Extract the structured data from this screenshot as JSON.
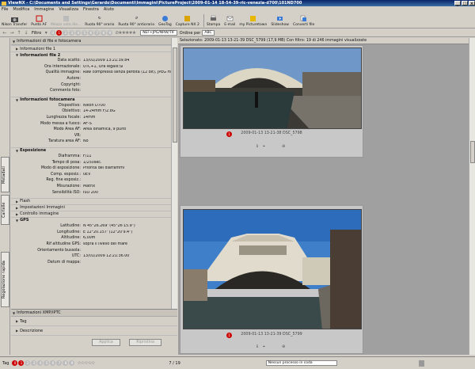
{
  "window": {
    "title": "ViewNX - C:\\Documents and Settings\\Gerardo\\Documenti\\Immagini\\PictureProject\\2009-01-14 18-54-39-ric-venezia-d700\\101ND700",
    "min": "_",
    "max": "□",
    "close": "×"
  },
  "menu": [
    "File",
    "Modifica",
    "Immagine",
    "Visualizza",
    "Finestra",
    "Aiuto"
  ],
  "toolbar": {
    "nikon_transfer": "Nikon Transfer",
    "punto_af": "Punto AF",
    "mezzo_voto": "Mezzo voto die...",
    "ruota_orario": "Ruota 90° orario",
    "ruota_antiorario": "Ruota 90° antiorario",
    "geotag": "GeoTag",
    "capture_nx2": "Capture NX 2",
    "stampa": "Stampa",
    "email": "E-mail",
    "my_picturetown": "my Picturetown",
    "slideshow": "Slideshow",
    "converti_file": "Converti file"
  },
  "filterbar": {
    "filtro": "Filtro",
    "labels": [
      "0",
      "1",
      "2",
      "3",
      "4",
      "5",
      "6",
      "7",
      "8",
      "9"
    ],
    "format_filter": "NEF+JPG/NRW/TIF",
    "sort_label": "Ordine per",
    "sort_icon": "ABC"
  },
  "sidetabs": {
    "metadati": "Metadati",
    "cartelle": "Cartelle",
    "regolazione": "Regolazione rapida"
  },
  "panel": {
    "header": "Informazioni di file e fotocamera",
    "file1": "Informazioni file 1",
    "file2": "Informazioni file 2",
    "file2_rows": [
      {
        "k": "Data scatto:",
        "v": "13/01/2009 13:21:39.84"
      },
      {
        "k": "Ora internazionale:",
        "v": "UTC+1, Ora legale:Sì"
      },
      {
        "k": "Qualità immagine:",
        "v": "Raw compresso senza perdita (12 bit), JPEG Fine"
      },
      {
        "k": "Autore:",
        "v": ""
      },
      {
        "k": "Copyright:",
        "v": ""
      },
      {
        "k": "Commento foto:",
        "v": ""
      }
    ],
    "camera": "Informazioni fotocamera",
    "camera_rows": [
      {
        "k": "Dispositivo:",
        "v": "Nikon D700"
      },
      {
        "k": "Obiettivo:",
        "v": "14-24mm F/2.8G"
      },
      {
        "k": "Lunghezza focale:",
        "v": "14mm"
      },
      {
        "k": "Modo messa a fuoco:",
        "v": "AF-S"
      },
      {
        "k": "Modo Area AF:",
        "v": "Area dinamica, 9 punti"
      },
      {
        "k": "VR:",
        "v": ""
      },
      {
        "k": "Taratura area AF:",
        "v": "No"
      }
    ],
    "exposure": "Esposizione",
    "exposure_rows": [
      {
        "k": "Diaframma:",
        "v": "F/11"
      },
      {
        "k": "Tempo di posa:",
        "v": "1/250sec."
      },
      {
        "k": "Modo di esposizione:",
        "v": "Priorità dei diaframmi"
      },
      {
        "k": "Comp. esposiz.:",
        "v": "0EV"
      },
      {
        "k": "Reg. fine esposiz.:",
        "v": ""
      },
      {
        "k": "Misurazione:",
        "v": "Matrix"
      },
      {
        "k": "Sensibilità ISO:",
        "v": "ISO 200"
      }
    ],
    "flash": "Flash",
    "image_settings": "Impostazioni Immagini",
    "image_control": "Controllo immagine",
    "gps": "GPS",
    "gps_rows": [
      {
        "k": "Latitudine:",
        "v": "N 45°26.269' (45°26'15.9\")"
      },
      {
        "k": "Longitudine:",
        "v": "E 12°20.157' (12°20'9.4\")"
      },
      {
        "k": "Altitudine:",
        "v": "6,00m"
      },
      {
        "k": "Rif altitudine GPS:",
        "v": "sopra il livello del mare"
      },
      {
        "k": "Orientamento bussola:",
        "v": ""
      },
      {
        "k": "UTC:",
        "v": "13/01/2009 12:21:36.00"
      },
      {
        "k": "Datum di mappa:",
        "v": ""
      }
    ],
    "xmp": "Informazioni XMP/IPTC",
    "tag": "Tag",
    "descrizione": "Descrizione",
    "applica": "Applica",
    "ripristina": "Ripristina"
  },
  "main": {
    "info": "Selezionato: 2009-01-13 13-21-39 DSC_5799 (17,9 MB)  Con filtro: 19 di 246 immagini visualizzate",
    "caption1": "2009-01-13 13-21-38 DSC_5798",
    "caption2": "2009-01-13 13-21-39 DSC_5799",
    "label_value": "1"
  },
  "status": {
    "tag": "Tag",
    "page": "7 / 19",
    "process": "Nessun processo in coda",
    "labels": [
      "0",
      "1",
      "2",
      "3",
      "4",
      "5",
      "6",
      "7",
      "8",
      "9"
    ]
  },
  "colors": {
    "accent": "#0a246a",
    "label_red": "#cc0000"
  }
}
